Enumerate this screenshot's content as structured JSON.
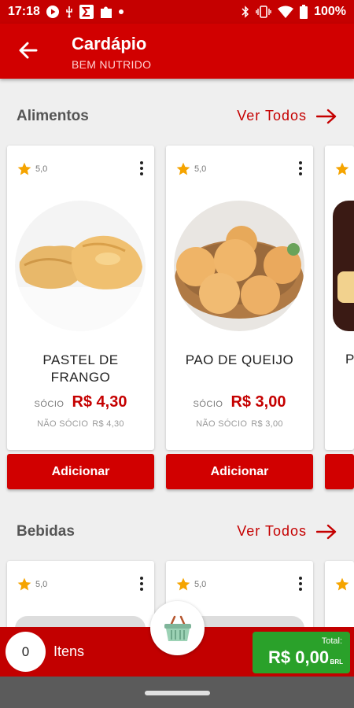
{
  "status_bar": {
    "time": "17:18",
    "battery": "100%",
    "icons": [
      "play-icon",
      "usb-icon",
      "sigma-icon",
      "puzzle-icon",
      "dot-icon",
      "bluetooth-icon",
      "vibrate-icon",
      "wifi-icon",
      "battery-icon"
    ]
  },
  "header": {
    "title": "Cardápio",
    "subtitle": "BEM NUTRIDO",
    "back_icon": "arrow-left-icon"
  },
  "sections": [
    {
      "title": "Alimentos",
      "see_all": "Ver Todos",
      "products": [
        {
          "rating": "5,0",
          "name": "PASTEL DE FRANGO",
          "member_label": "SÓCIO",
          "member_price": "R$ 4,30",
          "nonmember_label": "NÃO SÓCIO",
          "nonmember_price": "R$ 4,30",
          "button": "Adicionar"
        },
        {
          "rating": "5,0",
          "name": "PAO DE QUEIJO",
          "member_label": "SÓCIO",
          "member_price": "R$ 3,00",
          "nonmember_label": "NÃO SÓCIO",
          "nonmember_price": "R$ 3,00",
          "button": "Adicionar"
        },
        {
          "rating": "",
          "name": "P",
          "member_label": "",
          "member_price": "",
          "nonmember_label": "",
          "nonmember_price": "",
          "button": ""
        }
      ]
    },
    {
      "title": "Bebidas",
      "see_all": "Ver Todos",
      "products": [
        {
          "rating": "5,0"
        },
        {
          "rating": "5,0"
        },
        {
          "rating": ""
        }
      ]
    }
  ],
  "cart": {
    "count": "0",
    "items_label": "Itens",
    "total_label": "Total:",
    "total_value": "R$ 0,00",
    "currency": "BRL",
    "basket_icon": "basket-icon"
  },
  "colors": {
    "primary": "#d10000",
    "status_bar": "#c50000",
    "total_green": "#2aa12a",
    "star": "#f5a400",
    "background": "#efefef"
  }
}
